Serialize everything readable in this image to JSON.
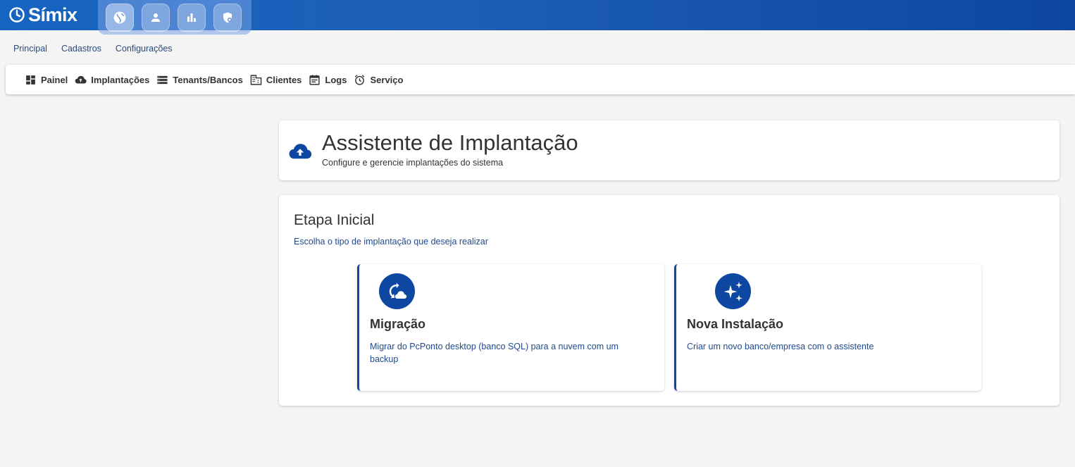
{
  "app": {
    "logo_text": "Símix",
    "top_icons": [
      "globe-icon",
      "person-icon",
      "bar-chart-icon",
      "shield-icon"
    ]
  },
  "menu": {
    "items": [
      "Principal",
      "Cadastros",
      "Configurações"
    ]
  },
  "toolbar": {
    "items": [
      {
        "label": "Painel",
        "icon": "dashboard-icon"
      },
      {
        "label": "Implantações",
        "icon": "cloud-upload-icon"
      },
      {
        "label": "Tenants/Bancos",
        "icon": "storage-icon"
      },
      {
        "label": "Clientes",
        "icon": "building-icon"
      },
      {
        "label": "Logs",
        "icon": "event-note-icon"
      },
      {
        "label": "Serviço",
        "icon": "alarm-icon"
      }
    ]
  },
  "header": {
    "title": "Assistente de Implantação",
    "subtitle": "Configure e gerencie implantações do sistema",
    "icon": "cloud-upload-icon"
  },
  "step": {
    "title": "Etapa Inicial",
    "subtitle": "Escolha o tipo de implantação que deseja realizar",
    "options": [
      {
        "title": "Migração",
        "description": "Migrar do PcPonto desktop (banco SQL) para a nuvem com um backup",
        "icon": "cloud-sync-icon"
      },
      {
        "title": "Nova Instalação",
        "description": "Criar um novo banco/empresa com o assistente",
        "icon": "sparkle-icon"
      }
    ]
  },
  "colors": {
    "primary": "#0d47a1",
    "topbar": "#1565c0",
    "link": "#1f4a8c",
    "background": "#f4f4f4"
  }
}
